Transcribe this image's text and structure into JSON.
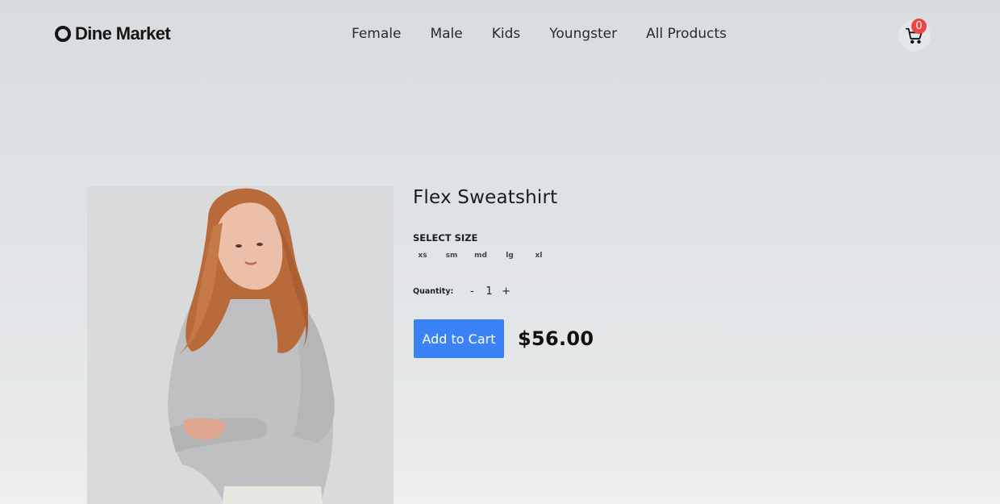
{
  "header": {
    "logo_text": "Dine Market",
    "nav": [
      "Female",
      "Male",
      "Kids",
      "Youngster",
      "All Products"
    ],
    "cart_count": "0"
  },
  "product": {
    "title": "Flex Sweatshirt",
    "size_label": "SELECT SIZE",
    "sizes": [
      "xs",
      "sm",
      "md",
      "lg",
      "xl"
    ],
    "quantity_label": "Quantity:",
    "qty_minus": "-",
    "quantity": "1",
    "qty_plus": "+",
    "add_to_cart_label": "Add to Cart",
    "price": "$56.00"
  },
  "colors": {
    "accent": "#3b82f6",
    "badge": "#ef4444"
  }
}
